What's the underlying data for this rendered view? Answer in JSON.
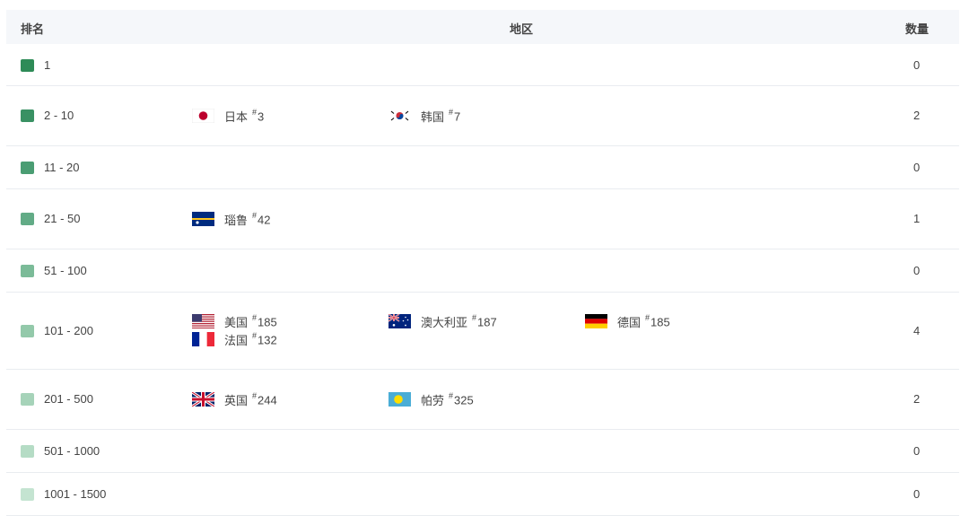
{
  "header": {
    "rank": "排名",
    "region": "地区",
    "count": "数量"
  },
  "rows": [
    {
      "rank": "1",
      "swatch": "#2e8b57",
      "count": "0",
      "countries": []
    },
    {
      "rank": "2 - 10",
      "swatch": "#399163",
      "count": "2",
      "countries": [
        {
          "name": "日本",
          "rank": "3",
          "flag": "japan-flag-icon"
        },
        {
          "name": "韩国",
          "rank": "7",
          "flag": "korea-flag-icon"
        }
      ]
    },
    {
      "rank": "11 - 20",
      "swatch": "#4a9d73",
      "count": "0",
      "countries": []
    },
    {
      "rank": "21 - 50",
      "swatch": "#62ab86",
      "count": "1",
      "countries": [
        {
          "name": "瑙鲁",
          "rank": "42",
          "flag": "nauru-flag-icon"
        }
      ]
    },
    {
      "rank": "51 - 100",
      "swatch": "#7bbb98",
      "count": "0",
      "countries": []
    },
    {
      "rank": "101 - 200",
      "swatch": "#93c9aa",
      "count": "4",
      "countries": [
        {
          "name": "美国",
          "rank": "185",
          "flag": "usa-flag-icon"
        },
        {
          "name": "澳大利亚",
          "rank": "187",
          "flag": "australia-flag-icon"
        },
        {
          "name": "德国",
          "rank": "185",
          "flag": "germany-flag-icon"
        },
        {
          "name": "法国",
          "rank": "132",
          "flag": "france-flag-icon"
        }
      ]
    },
    {
      "rank": "201 - 500",
      "swatch": "#a6d3b9",
      "count": "2",
      "countries": [
        {
          "name": "英国",
          "rank": "244",
          "flag": "uk-flag-icon"
        },
        {
          "name": "帕劳",
          "rank": "325",
          "flag": "palau-flag-icon"
        }
      ]
    },
    {
      "rank": "501 - 1000",
      "swatch": "#b5dcc5",
      "count": "0",
      "countries": []
    },
    {
      "rank": "1001 - 1500",
      "swatch": "#c4e4d1",
      "count": "0",
      "countries": []
    }
  ]
}
